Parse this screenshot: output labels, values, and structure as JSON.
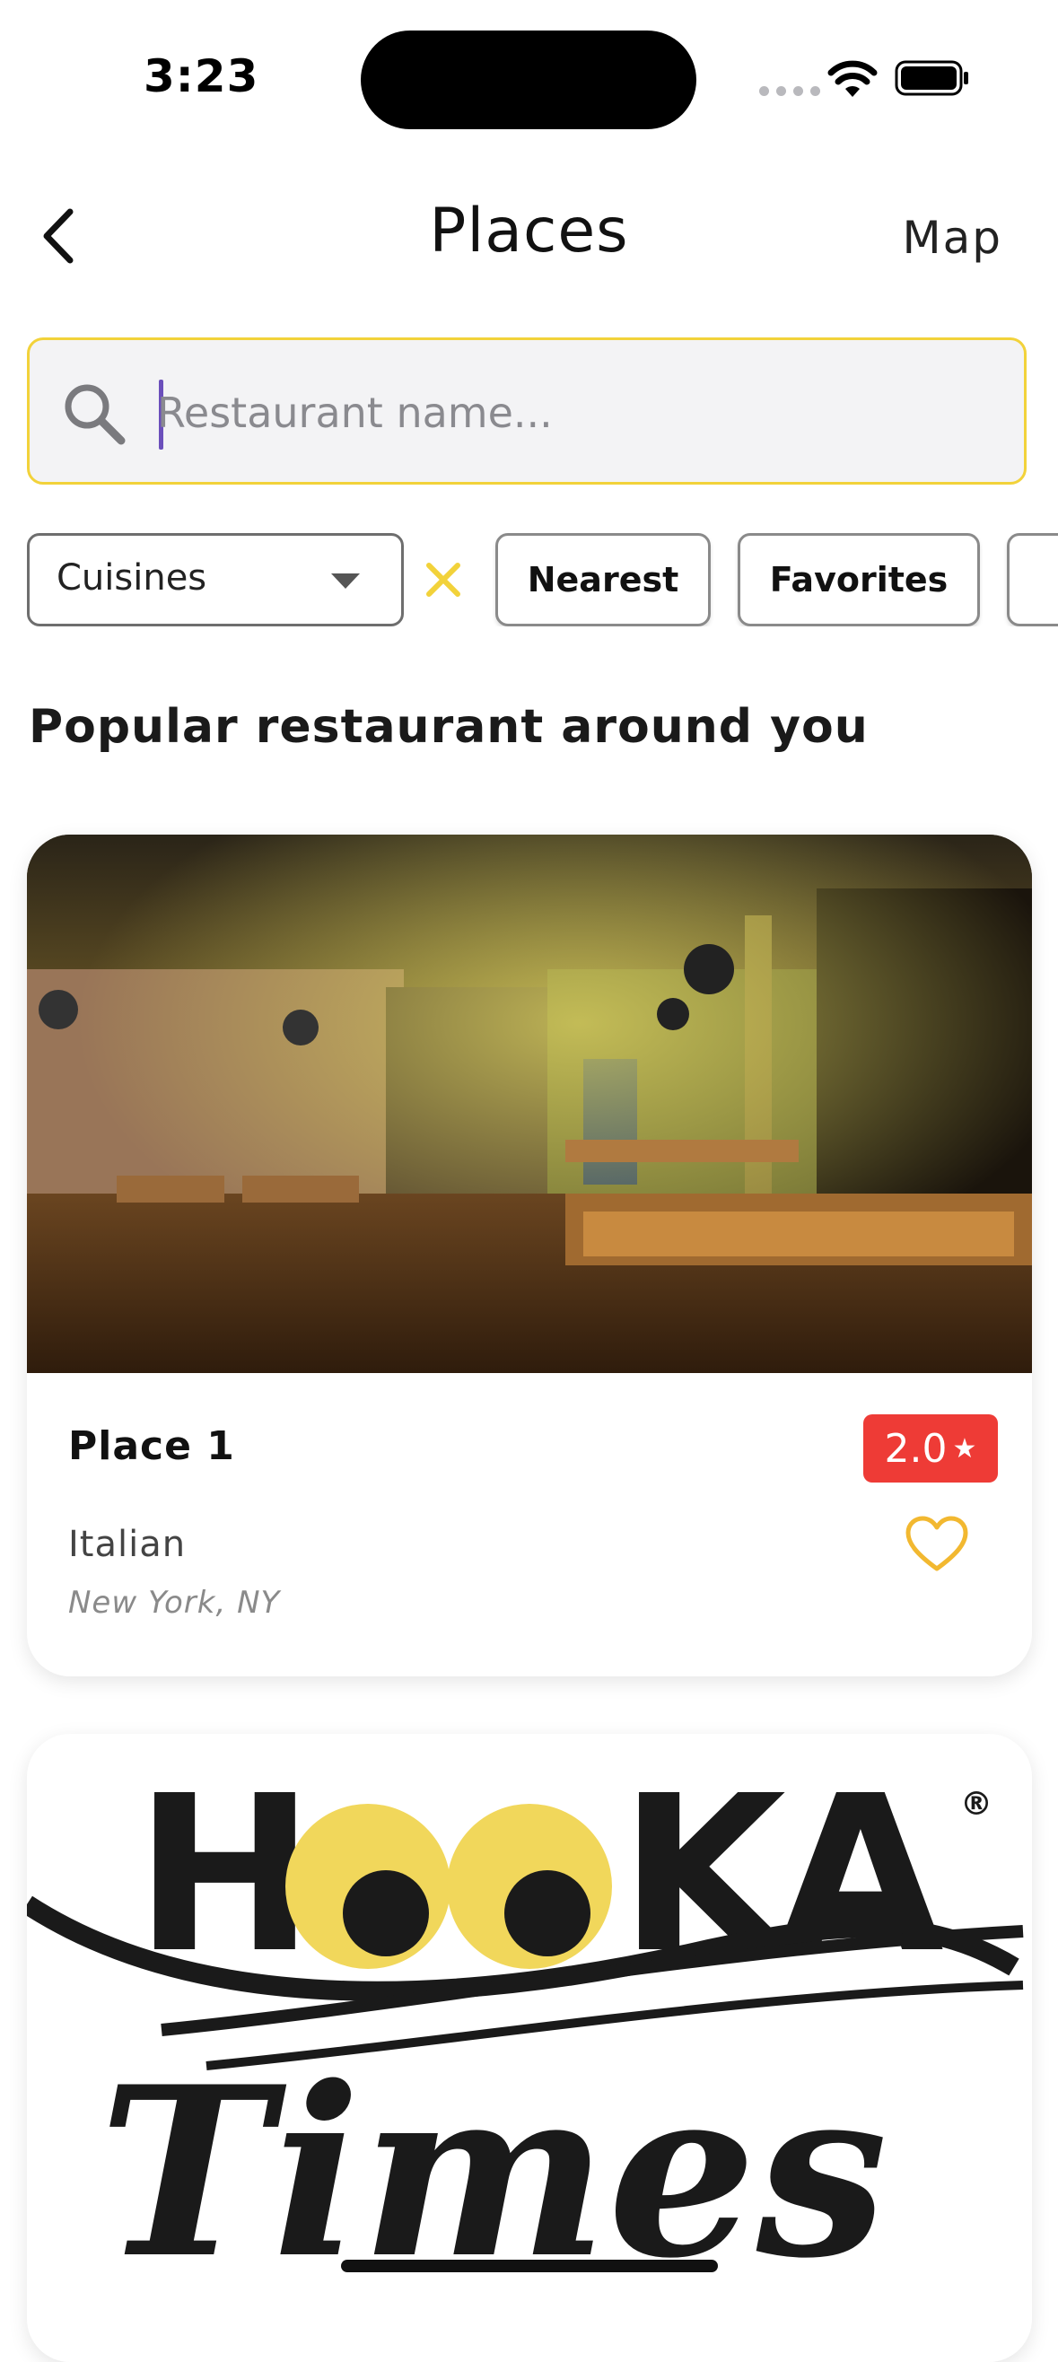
{
  "status_bar": {
    "time": "3:23"
  },
  "nav": {
    "title": "Places",
    "map_label": "Map"
  },
  "search": {
    "placeholder": "Restaurant name..."
  },
  "filters": {
    "cuisines_label": "Cuisines",
    "chips": [
      "Nearest",
      "Favorites"
    ]
  },
  "section": {
    "title": "Popular restaurant around you"
  },
  "places": [
    {
      "name": "Place 1",
      "rating": "2.0",
      "cuisine": "Italian",
      "location": "New York, NY"
    }
  ],
  "logo_text": {
    "line1": "HOOKA",
    "line2": "Times"
  },
  "colors": {
    "accent_yellow": "#f2d23a",
    "rating_red": "#ee3b36",
    "caret_purple": "#6b4fbb",
    "heart_gold": "#f2b830"
  }
}
